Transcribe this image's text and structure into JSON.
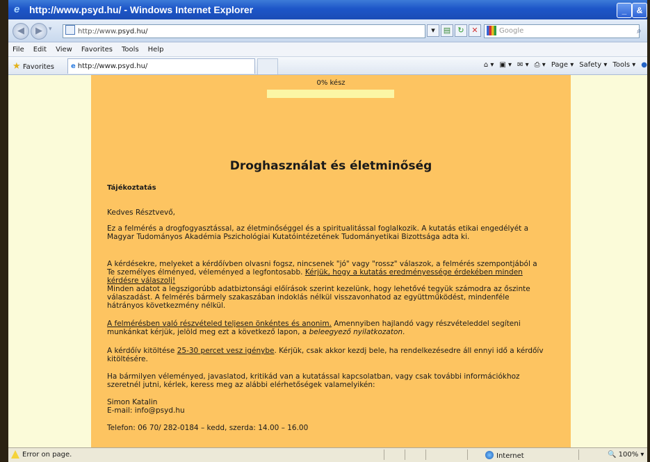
{
  "window": {
    "title": "http://www.psyd.hu/ - Windows Internet Explorer",
    "minimize": "_",
    "restore": "&"
  },
  "address": {
    "url_prefix": "http://www.",
    "url_domain": "psyd.hu/",
    "search_placeholder": "Google",
    "search_engine_icon": "google-icon"
  },
  "menu": [
    "File",
    "Edit",
    "View",
    "Favorites",
    "Tools",
    "Help"
  ],
  "favorites_bar": {
    "favorites_label": "Favorites",
    "tab_title": "http://www.psyd.hu/",
    "commands": [
      "Page ▾",
      "Safety ▾",
      "Tools ▾"
    ]
  },
  "page": {
    "progress_label": "0% kész",
    "progress_fraction": 0,
    "title": "Droghasználat és életminőség",
    "subheading": "Tájékoztatás",
    "greeting": "Kedves Résztvevő,",
    "para1": "Ez a felmérés a drogfogyasztással, az életminőséggel és a spiritualitással foglalkozik. A kutatás etikai engedélyét a Magyar Tudományos Akadémia Pszichológiai Kutatóintézetének Tudományetikai Bizottsága adta ki.",
    "para2_a": "A kérdésekre, melyeket a kérdőívben olvasni fogsz, nincsenek \"jó\" vagy \"rossz\" válaszok, a felmérés szempontjából a Te személyes élményed, véleményed a legfontosabb. ",
    "para2_link": "Kérjük, hogy a kutatás eredményessége érdekében minden kérdésre válaszolj!",
    "para2_b": "Minden adatot a legszigorúbb adatbiztonsági előírások szerint kezelünk, hogy lehetővé tegyük számodra az őszinte válaszadást. A felmérés bármely szakaszában indoklás nélkül visszavonhatod az együttműködést, mindenféle hátrányos következmény nélkül.",
    "para3_link": "A felmérésben való részvételed teljesen önkéntes és anonim.",
    "para3_a": " Amennyiben hajlandó vagy részvételeddel segíteni munkánkat kérjük, jelöld meg ezt a következő lapon, a ",
    "para3_italic": "beleegyező nyilatkozaton",
    "para3_b": ".",
    "para4_a": "A kérdőív kitöltése ",
    "para4_link": "25-30 percet vesz igénybe",
    "para4_b": ". Kérjük, csak akkor kezdj bele, ha rendelkezésedre áll ennyi idő a kérdőív kitöltésére.",
    "para5": "Ha bármilyen véleményed, javaslatod, kritikád van a kutatással kapcsolatban, vagy csak további információkhoz szeretnél jutni, kérlek, keress meg az alábbi elérhetőségek valamelyikén:",
    "contact_name": "Simon Katalin",
    "contact_email": "E-mail: info@psyd.hu",
    "contact_phone": "Telefon: 06 70/ 282-0184 – kedd, szerda: 14.00 – 16.00"
  },
  "status": {
    "text": "Error on page.",
    "zone": "Internet",
    "zoom": "100%"
  },
  "colors": {
    "page_column": "#fdc461",
    "side_background": "#fbfbd9",
    "progress_track": "#fbf6a5"
  }
}
